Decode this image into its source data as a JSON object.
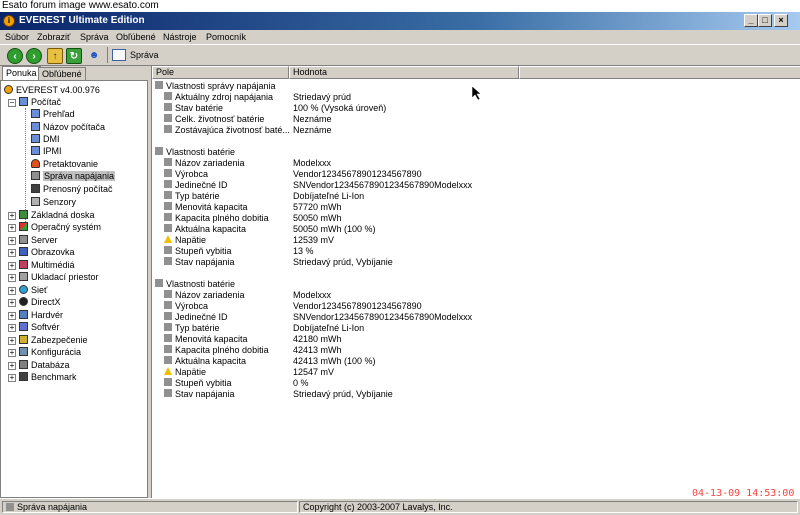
{
  "watermark": "Esato forum image www.esato.com",
  "window": {
    "title": "EVEREST Ultimate Edition"
  },
  "menu": [
    "Súbor",
    "Zobraziť",
    "Správa",
    "Obľúbené",
    "Nástroje",
    "Pomocník"
  ],
  "toolbar": {
    "report_label": "Správa"
  },
  "tabs": [
    "Ponuka",
    "Obľúbené"
  ],
  "tree": {
    "root": "EVEREST v4.00.976",
    "computer": "Počítač",
    "children": [
      "Prehľad",
      "Názov počítača",
      "DMI",
      "IPMI",
      "Pretaktovanie",
      "Správa napájania",
      "Prenosný počítač",
      "Senzory"
    ],
    "selected": "Správa napájania",
    "groups": [
      "Základná doska",
      "Operačný systém",
      "Server",
      "Obrazovka",
      "Multimédiá",
      "Ukladací priestor",
      "Sieť",
      "DirectX",
      "Hardvér",
      "Softvér",
      "Zabezpečenie",
      "Konfigurácia",
      "Databáza",
      "Benchmark"
    ]
  },
  "columns": {
    "field": "Pole",
    "value": "Hodnota"
  },
  "sections": [
    {
      "title": "Vlastnosti správy napájania",
      "rows": [
        {
          "field": "Aktuálny zdroj napájania",
          "value": "Striedavý prúd"
        },
        {
          "field": "Stav batérie",
          "value": "100 % (Vysoká úroveň)"
        },
        {
          "field": "Celk. životnosť batérie",
          "value": "Neznáme"
        },
        {
          "field": "Zostávajúca životnosť baté...",
          "value": "Neznáme"
        }
      ]
    },
    {
      "title": "Vlastnosti batérie",
      "rows": [
        {
          "field": "Názov zariadenia",
          "value": "Modelxxx"
        },
        {
          "field": "Výrobca",
          "value": "Vendor12345678901234567890"
        },
        {
          "field": "Jedinečné ID",
          "value": "SNVendor12345678901234567890Modelxxx"
        },
        {
          "field": "Typ batérie",
          "value": "Dobíjateľné Li-Ion"
        },
        {
          "field": "Menovitá kapacita",
          "value": "57720 mWh"
        },
        {
          "field": "Kapacita plného dobitia",
          "value": "50050 mWh"
        },
        {
          "field": "Aktuálna kapacita",
          "value": "50050 mWh  (100 %)"
        },
        {
          "field": "Napätie",
          "value": "12539 mV",
          "warn": true
        },
        {
          "field": "Stupeň vybitia",
          "value": "13 %"
        },
        {
          "field": "Stav napájania",
          "value": "Striedavý prúd, Vybíjanie"
        }
      ]
    },
    {
      "title": "Vlastnosti batérie",
      "rows": [
        {
          "field": "Názov zariadenia",
          "value": "Modelxxx"
        },
        {
          "field": "Výrobca",
          "value": "Vendor12345678901234567890"
        },
        {
          "field": "Jedinečné ID",
          "value": "SNVendor12345678901234567890Modelxxx"
        },
        {
          "field": "Typ batérie",
          "value": "Dobíjateľné Li-Ion"
        },
        {
          "field": "Menovitá kapacita",
          "value": "42180 mWh"
        },
        {
          "field": "Kapacita plného dobitia",
          "value": "42413 mWh"
        },
        {
          "field": "Aktuálna kapacita",
          "value": "42413 mWh  (100 %)"
        },
        {
          "field": "Napätie",
          "value": "12547 mV",
          "warn": true
        },
        {
          "field": "Stupeň vybitia",
          "value": "0 %"
        },
        {
          "field": "Stav napájania",
          "value": "Striedavý prúd, Vybíjanie"
        }
      ]
    }
  ],
  "status": {
    "left": "Správa napájania",
    "right": "Copyright (c) 2003-2007 Lavalys, Inc."
  },
  "datestamp": "04-13-09  14:53:00",
  "colors": {
    "accent": "#0a246a",
    "datestamp": "#ff4040"
  }
}
